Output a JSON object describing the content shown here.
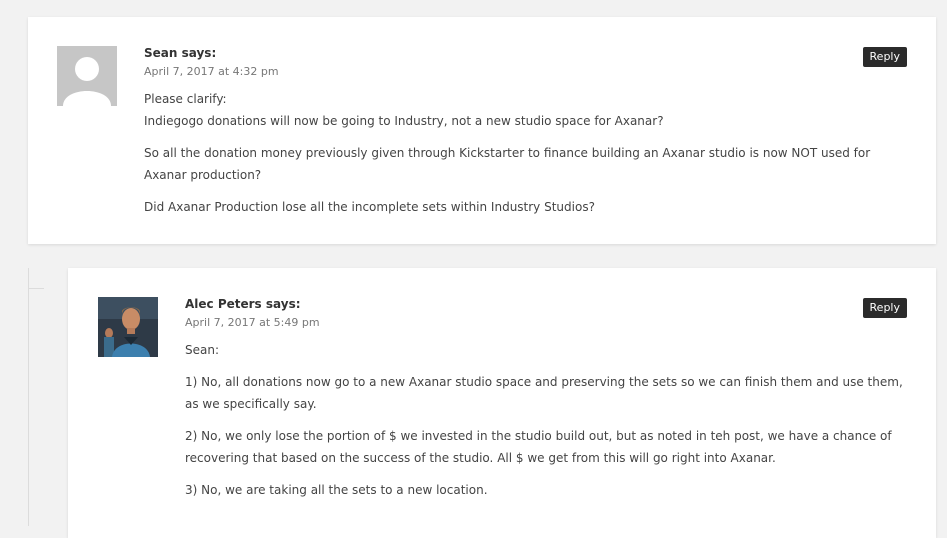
{
  "comments": [
    {
      "author": "Sean",
      "says": "says:",
      "date": "April 7, 2017 at 4:32 pm",
      "reply_label": "Reply",
      "avatar": "default-avatar-icon",
      "paragraphs": [
        "Please clarify:",
        "Indiegogo donations will now be going to Industry, not a new studio space for Axanar?",
        "So all the donation money previously given through Kickstarter to finance building an Axanar studio is now NOT used for Axanar production?",
        "Did Axanar Production lose all the incomplete sets within Industry Studios?"
      ]
    },
    {
      "author": "Alec Peters",
      "says": "says:",
      "date": "April 7, 2017 at 5:49 pm",
      "reply_label": "Reply",
      "avatar": "user-photo-avatar",
      "paragraphs": [
        "Sean:",
        "1) No, all donations now go to a new Axanar studio space and preserving the sets so we can finish them and use them, as we specifically say.",
        "2) No, we only lose the portion of $ we invested in the studio build out, but as noted in teh post, we have a chance of recovering that based on the success of the studio. All $ we get from this will go right into Axanar.",
        "3) No, we are taking all the sets to a new location."
      ]
    }
  ],
  "colors": {
    "page_background": "#f2f2f2",
    "card_background": "#ffffff",
    "reply_button": "#2b2b2b",
    "date_text": "#777777"
  }
}
